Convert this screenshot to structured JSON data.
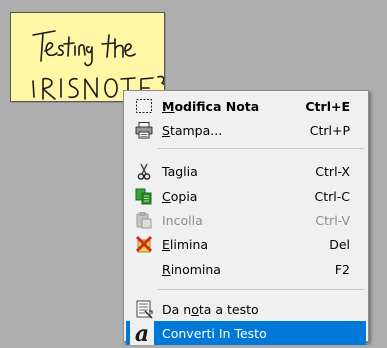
{
  "note": {
    "handwriting_line1": "Testing the",
    "handwriting_line2": "IRISNOTE 3"
  },
  "menu": {
    "items": [
      {
        "pre": "",
        "mn": "M",
        "post": "odifica Nota",
        "shortcut": "Ctrl+E",
        "icon": "select-rectangle-icon",
        "bold": true
      },
      {
        "pre": "",
        "mn": "S",
        "post": "tampa...",
        "shortcut": "Ctrl+P",
        "icon": "printer-icon"
      },
      {
        "pre": "",
        "mn": "",
        "post": "Taglia",
        "shortcut": "Ctrl-X",
        "icon": "scissors-icon"
      },
      {
        "pre": "",
        "mn": "C",
        "post": "opia",
        "shortcut": "Ctrl-C",
        "icon": "copy-icon"
      },
      {
        "pre": "",
        "mn": "",
        "post": "Incolla",
        "shortcut": "Ctrl-V",
        "icon": "paste-icon",
        "disabled": true
      },
      {
        "pre": "",
        "mn": "E",
        "post": "limina",
        "shortcut": "Del",
        "icon": "delete-x-icon"
      },
      {
        "pre": "",
        "mn": "R",
        "post": "inomina",
        "shortcut": "F2",
        "icon": ""
      },
      {
        "pre": "Da n",
        "mn": "o",
        "post": "ta a testo",
        "shortcut": "",
        "icon": "note-to-text-icon"
      },
      {
        "pre": "",
        "mn": "",
        "post": "Converti In Testo",
        "shortcut": "",
        "icon": "script-a-icon",
        "selected": true
      }
    ]
  },
  "colors": {
    "background": "#aeaeae",
    "note": "#fff7a6",
    "menu": "#f0f0f0",
    "highlight": "#0078d7",
    "delete_red": "#d62a1a"
  }
}
